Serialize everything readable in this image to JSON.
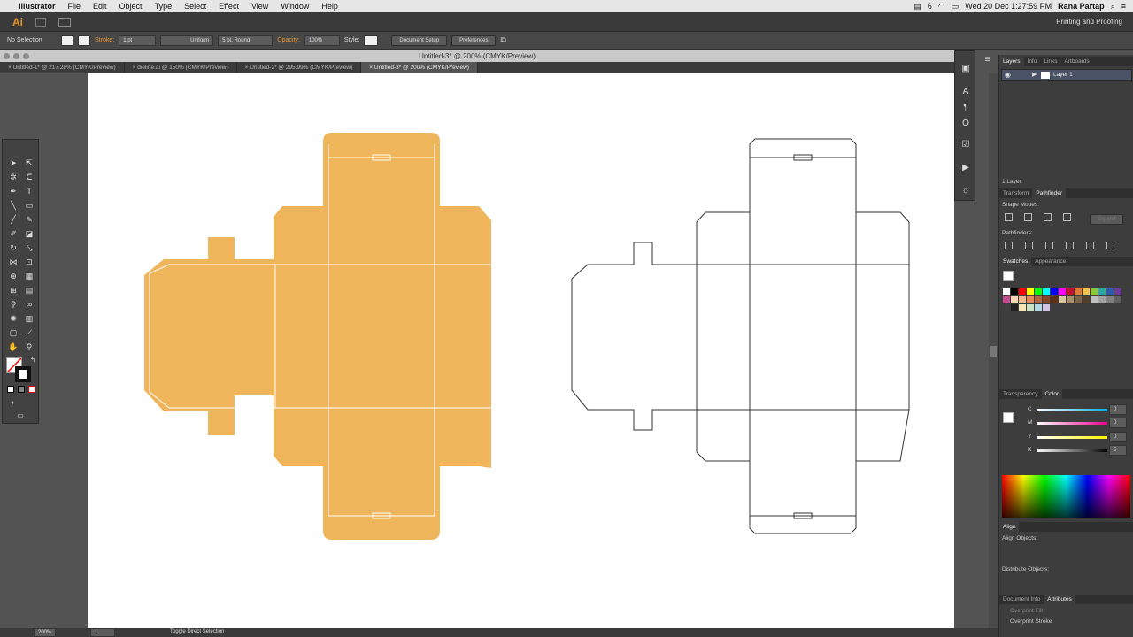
{
  "menubar": {
    "apple": "",
    "app": "Illustrator",
    "items": [
      "File",
      "Edit",
      "Object",
      "Type",
      "Select",
      "Effect",
      "View",
      "Window",
      "Help"
    ],
    "status_num": "6",
    "datetime": "Wed 20 Dec  1:27:59 PM",
    "user": "Rana Partap"
  },
  "appbar": {
    "logo": "Ai",
    "workspace": "Printing and Proofing"
  },
  "control": {
    "selection": "No Selection",
    "stroke_label": "Stroke:",
    "stroke_weight": "1 pt",
    "profile": "Uniform",
    "brush": "5 pt. Round",
    "opacity_label": "Opacity:",
    "opacity": "100%",
    "style_label": "Style:",
    "doc_setup": "Document Setup",
    "preferences": "Preferences"
  },
  "document": {
    "title": "Untitled-3* @ 200% (CMYK/Preview)",
    "tabs": [
      "Untitled-1* @ 217.28% (CMYK/Preview)",
      "dieline.ai @ 150% (CMYK/Preview)",
      "Untitled-2* @ 295.99% (CMYK/Preview)",
      "Untitled-3* @ 200% (CMYK/Preview)"
    ],
    "active_tab": 3
  },
  "dieline": {
    "fill_color": "#efb55a",
    "line_color": "#ffffff",
    "outline_color": "#333333"
  },
  "layers": {
    "tabs": [
      "Layers",
      "Info",
      "Links",
      "Artboards"
    ],
    "layer_name": "Layer 1",
    "count": "1 Layer"
  },
  "transform": {
    "tabs": [
      "Transform",
      "Pathfinder"
    ],
    "shape_modes": "Shape Modes:",
    "expand": "Expand",
    "pathfinders": "Pathfinders:"
  },
  "swatches": {
    "tabs": [
      "Swatches",
      "Appearance"
    ],
    "colors": [
      "#ffffff",
      "#000000",
      "#ff0000",
      "#ffff00",
      "#00ff00",
      "#00ffff",
      "#0000ff",
      "#ff00ff",
      "#c8102e",
      "#e07b39",
      "#f2c14e",
      "#8cc63f",
      "#27a9a1",
      "#2e5aa8",
      "#6a3d9a",
      "#c74b8e",
      "#f7d7b5",
      "#f0b78a",
      "#e58b5b",
      "#b5653d",
      "#86462a",
      "#5b3218",
      "#d9c7a4",
      "#a8906a",
      "#7a6548",
      "#4f3f2b",
      "#c0c0c0",
      "#a0a0a0",
      "#808080",
      "#606060",
      "#404040",
      "#202020",
      "#f5e6b3",
      "#c9e4c5",
      "#b3d9e6",
      "#d6c2e6"
    ]
  },
  "color": {
    "tabs": [
      "Transparency",
      "Color"
    ],
    "c": "0",
    "m": "0",
    "y": "0",
    "k": "5"
  },
  "align": {
    "title": "Align",
    "align_objects": "Align Objects:",
    "distribute_objects": "Distribute Objects:"
  },
  "attributes": {
    "tabs": [
      "Document Info",
      "Attributes"
    ],
    "overprint_fill": "Overprint Fill",
    "overprint_stroke": "Overprint Stroke"
  },
  "status": {
    "zoom": "200%",
    "artboard": "1",
    "tool": "Toggle Direct Selection"
  }
}
